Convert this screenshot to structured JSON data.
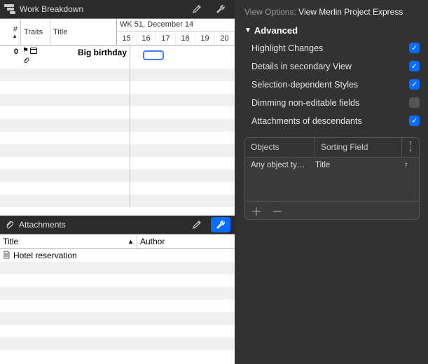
{
  "work_breakdown": {
    "panel_title": "Work Breakdown",
    "columns": {
      "num": "#",
      "traits": "Traits",
      "title": "Title"
    },
    "week_header": "WK 51, December 14",
    "days": [
      "15",
      "16",
      "17",
      "18",
      "19",
      "20"
    ],
    "row": {
      "num": "0",
      "title": "Big birthday",
      "traits": {
        "flag": "⚑",
        "calendar": "📅",
        "clip": "📎"
      }
    }
  },
  "attachments": {
    "panel_title": "Attachments",
    "columns": {
      "title": "Title",
      "author": "Author"
    },
    "items": [
      {
        "title": "Hotel reservation"
      }
    ]
  },
  "inspector": {
    "view_options_label": "View Options:",
    "view_options_value": "View Merlin Project Express",
    "section_title": "Advanced",
    "options": [
      {
        "label": "Highlight Changes",
        "checked": true
      },
      {
        "label": "Details in secondary View",
        "checked": true
      },
      {
        "label": "Selection-dependent Styles",
        "checked": true
      },
      {
        "label": "Dimming non-editable fields",
        "checked": false
      },
      {
        "label": "Attachments of descendants",
        "checked": true
      }
    ],
    "sort_table": {
      "headers": {
        "objects": "Objects",
        "sorting_field": "Sorting Field"
      },
      "rows": [
        {
          "object": "Any object ty…",
          "field": "Title",
          "dir": "↑"
        }
      ],
      "direction_header": "↑↓"
    }
  }
}
